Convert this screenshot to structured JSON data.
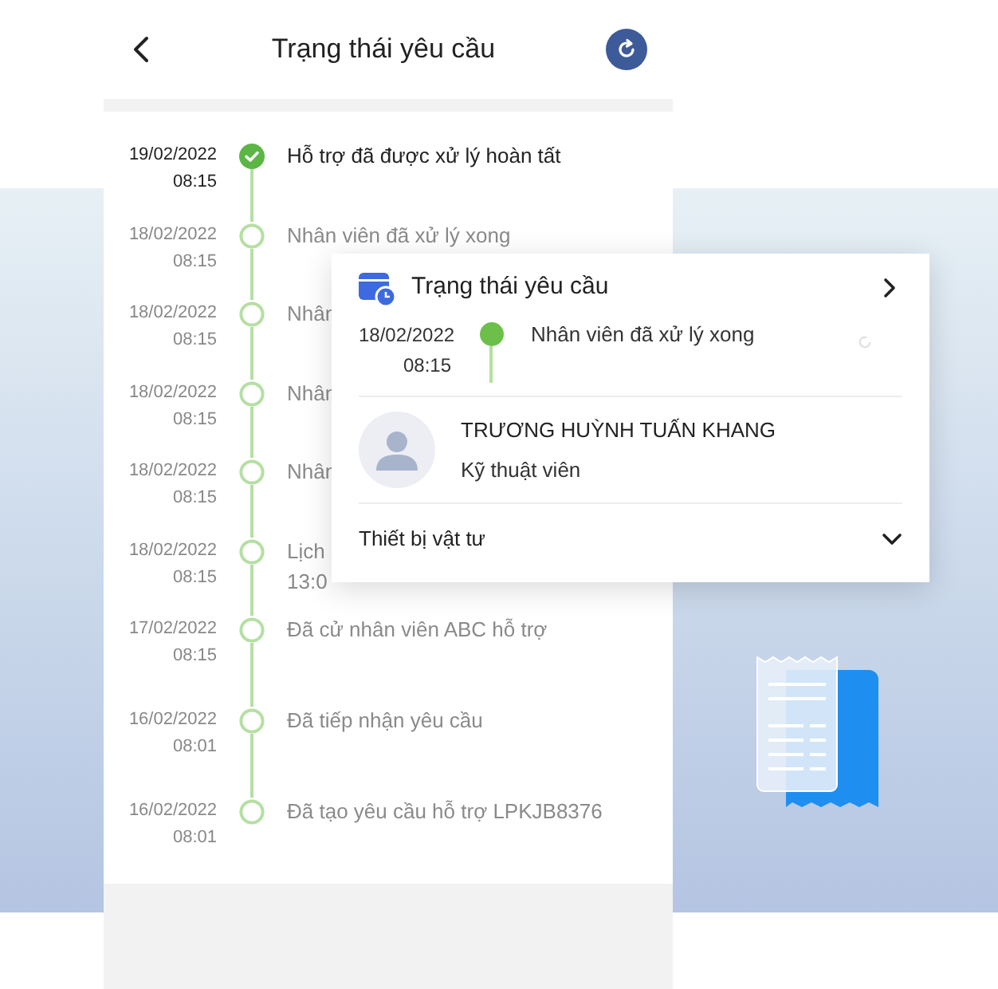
{
  "header": {
    "title": "Trạng thái yêu cầu"
  },
  "timeline": [
    {
      "date": "19/02/2022",
      "time": "08:15",
      "lines": [
        "Hỗ trợ đã được xử lý hoàn tất"
      ],
      "done": true
    },
    {
      "date": "18/02/2022",
      "time": "08:15",
      "lines": [
        "Nhân viên đã xử lý xong"
      ],
      "done": false
    },
    {
      "date": "18/02/2022",
      "time": "08:15",
      "lines": [
        "Nhân"
      ],
      "done": false
    },
    {
      "date": "18/02/2022",
      "time": "08:15",
      "lines": [
        "Nhân"
      ],
      "done": false
    },
    {
      "date": "18/02/2022",
      "time": "08:15",
      "lines": [
        "Nhân"
      ],
      "done": false
    },
    {
      "date": "18/02/2022",
      "time": "08:15",
      "lines": [
        "Lịch",
        "13:0"
      ],
      "done": false
    },
    {
      "date": "17/02/2022",
      "time": "08:15",
      "lines": [
        "Đã cử nhân viên ABC hỗ trợ"
      ],
      "done": false
    },
    {
      "date": "16/02/2022",
      "time": "08:01",
      "lines": [
        "Đã tiếp nhận yêu cầu"
      ],
      "done": false
    },
    {
      "date": "16/02/2022",
      "time": "08:01",
      "lines": [
        "Đã tạo yêu cầu hỗ trợ LPKJB8376"
      ],
      "done": false
    }
  ],
  "card": {
    "title": "Trạng thái yêu cầu",
    "status": {
      "date": "18/02/2022",
      "time": "08:15",
      "text": "Nhân viên đã xử lý xong"
    },
    "staff": {
      "name": "TRƯƠNG HUỲNH TUẤN KHANG",
      "role": "Kỹ thuật viên"
    },
    "section": {
      "label": "Thiết bị vật tư",
      "expanded": false
    }
  }
}
